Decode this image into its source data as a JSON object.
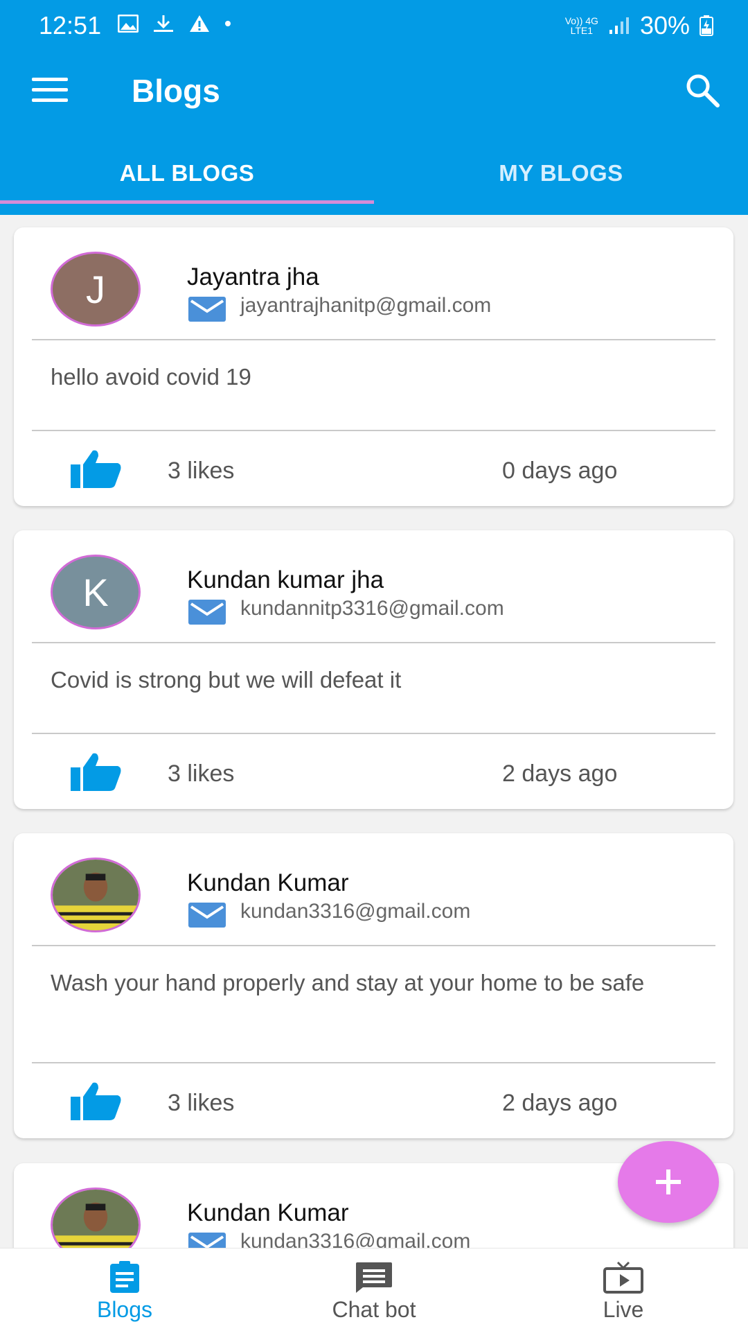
{
  "status_bar": {
    "time": "12:51",
    "network_top": "Vo)) 4G",
    "network_bottom": "LTE1",
    "battery": "30%"
  },
  "app_bar": {
    "title": "Blogs"
  },
  "tabs": [
    {
      "label": "ALL BLOGS",
      "active": true
    },
    {
      "label": "MY BLOGS",
      "active": false
    }
  ],
  "posts": [
    {
      "avatar_letter": "J",
      "avatar_color": "#8d6e63",
      "name": "Jayantra jha",
      "email": "jayantrajhanitp@gmail.com",
      "body": "hello avoid covid 19",
      "likes": "3 likes",
      "ago": "0 days ago"
    },
    {
      "avatar_letter": "K",
      "avatar_color": "#78909c",
      "name": "Kundan kumar jha",
      "email": "kundannitp3316@gmail.com",
      "body": "Covid is strong but we will defeat it",
      "likes": "3 likes",
      "ago": "2 days ago"
    },
    {
      "avatar_letter": "",
      "avatar_color": "#6d7a55",
      "name": "Kundan Kumar",
      "email": "kundan3316@gmail.com",
      "body": "Wash your hand properly and stay at your home to be safe",
      "likes": "3 likes",
      "ago": "2 days ago"
    },
    {
      "avatar_letter": "",
      "avatar_color": "#6d7a55",
      "name": "Kundan Kumar",
      "email": "kundan3316@gmail.com",
      "body": "",
      "likes": "",
      "ago": ""
    }
  ],
  "fab": {
    "icon": "plus-icon"
  },
  "bottom_nav": [
    {
      "label": "Blogs",
      "icon": "document-icon",
      "active": true
    },
    {
      "label": "Chat bot",
      "icon": "chat-icon",
      "active": false
    },
    {
      "label": "Live",
      "icon": "tv-icon",
      "active": false
    }
  ],
  "colors": {
    "primary": "#039be5",
    "accent": "#e57ae9",
    "tab_indicator": "#d48cd8",
    "mail_icon": "#4a90d9"
  }
}
